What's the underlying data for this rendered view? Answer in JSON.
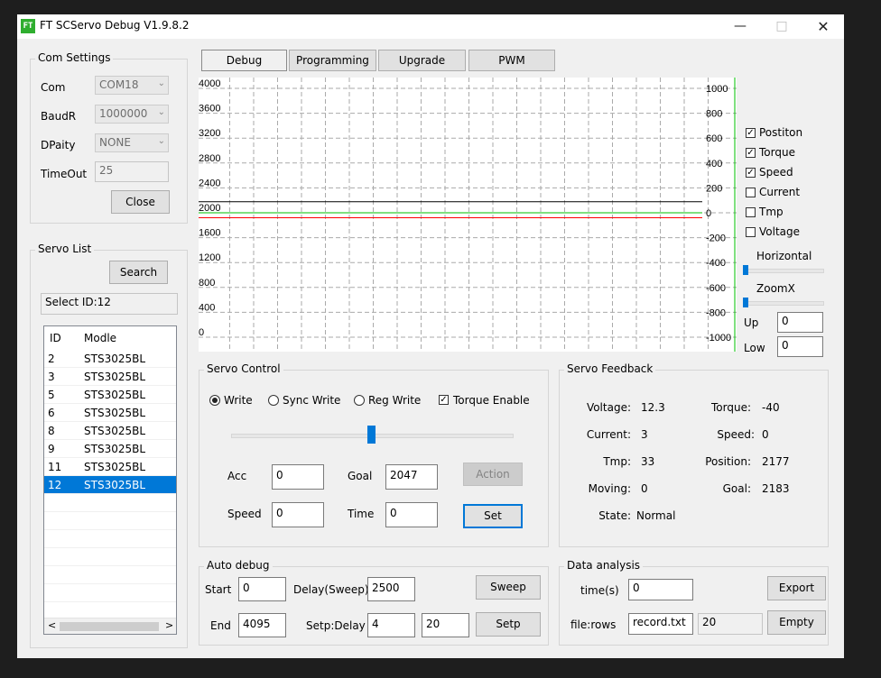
{
  "window": {
    "title": "FT SCServo Debug V1.9.8.2",
    "icon_text": "FT"
  },
  "com_settings": {
    "title": "Com Settings",
    "com_label": "Com",
    "com_value": "COM18",
    "baud_label": "BaudR",
    "baud_value": "1000000",
    "parity_label": "DPaity",
    "parity_value": "NONE",
    "timeout_label": "TimeOut",
    "timeout_value": "25",
    "close_label": "Close"
  },
  "servo_list": {
    "title": "Servo List",
    "search_label": "Search",
    "select_id": "Select ID:12",
    "headers": [
      "ID",
      "Modle"
    ],
    "rows": [
      {
        "id": "2",
        "model": "STS3025BL"
      },
      {
        "id": "3",
        "model": "STS3025BL"
      },
      {
        "id": "5",
        "model": "STS3025BL"
      },
      {
        "id": "6",
        "model": "STS3025BL"
      },
      {
        "id": "8",
        "model": "STS3025BL"
      },
      {
        "id": "9",
        "model": "STS3025BL"
      },
      {
        "id": "11",
        "model": "STS3025BL"
      },
      {
        "id": "12",
        "model": "STS3025BL"
      }
    ],
    "selected_id": "12"
  },
  "tabs": [
    "Debug",
    "Programming",
    "Upgrade",
    "PWM"
  ],
  "active_tab": "Debug",
  "chart_data": {
    "type": "line",
    "left_axis_ticks": [
      "4000",
      "3600",
      "3200",
      "2800",
      "2400",
      "2000",
      "1600",
      "1200",
      "800",
      "400",
      "0"
    ],
    "right_axis_ticks": [
      "1000",
      "800",
      "600",
      "400",
      "200",
      "0",
      "-200",
      "-400",
      "-600",
      "-800",
      "-1000"
    ],
    "ylim_left": [
      0,
      4000
    ],
    "ylim_right": [
      -1000,
      1000
    ],
    "grid": true,
    "series": [
      {
        "name": "Postiton",
        "color": "#000000",
        "axis": "left",
        "value": 2177
      },
      {
        "name": "Torque",
        "color": "#ff0000",
        "axis": "right",
        "value": -40
      },
      {
        "name": "Speed",
        "color": "#00c000",
        "axis": "right",
        "value": 0
      }
    ]
  },
  "series_toggles": [
    {
      "label": "Postiton",
      "checked": true
    },
    {
      "label": "Torque",
      "checked": true
    },
    {
      "label": "Speed",
      "checked": true
    },
    {
      "label": "Current",
      "checked": false
    },
    {
      "label": "Tmp",
      "checked": false
    },
    {
      "label": "Voltage",
      "checked": false
    }
  ],
  "view": {
    "horizontal_label": "Horizontal",
    "horizontal_level": 0,
    "zoomx_label": "ZoomX",
    "zoomx_level": 0,
    "up_label": "Up",
    "up_value": "0",
    "low_label": "Low",
    "low_value": "0"
  },
  "servo_control": {
    "title": "Servo Control",
    "write_label": "Write",
    "sync_write_label": "Sync Write",
    "reg_write_label": "Reg Write",
    "mode_selected": "Write",
    "torque_enable_label": "Torque Enable",
    "torque_enable": true,
    "slider_value": 2047,
    "slider_max": 4095,
    "acc_label": "Acc",
    "acc_value": "0",
    "goal_label": "Goal",
    "goal_value": "2047",
    "speed_label": "Speed",
    "speed_value": "0",
    "time_label": "Time",
    "time_value": "0",
    "action_label": "Action",
    "set_label": "Set"
  },
  "servo_feedback": {
    "title": "Servo Feedback",
    "voltage_label": "Voltage:",
    "voltage": "12.3",
    "torque_label": "Torque:",
    "torque": "-40",
    "current_label": "Current:",
    "current": "3",
    "speed_label": "Speed:",
    "speed": "0",
    "tmp_label": "Tmp:",
    "tmp": "33",
    "position_label": "Position:",
    "position": "2177",
    "moving_label": "Moving:",
    "moving": "0",
    "goal_label": "Goal:",
    "goal": "2183",
    "state_label": "State:",
    "state": "Normal"
  },
  "auto_debug": {
    "title": "Auto debug",
    "start_label": "Start",
    "start_value": "0",
    "delay_label": "Delay(Sweep)",
    "delay_value": "2500",
    "sweep_label": "Sweep",
    "end_label": "End",
    "end_value": "4095",
    "step_label": "Setp:Delay",
    "step_value": "4",
    "step_delay_value": "20",
    "setp_label": "Setp"
  },
  "data_analysis": {
    "title": "Data analysis",
    "time_label": "time(s)",
    "time_value": "0",
    "export_label": "Export",
    "file_label": "file:rows",
    "file_value": "record.txt",
    "rows_value": "20",
    "empty_label": "Empty"
  }
}
